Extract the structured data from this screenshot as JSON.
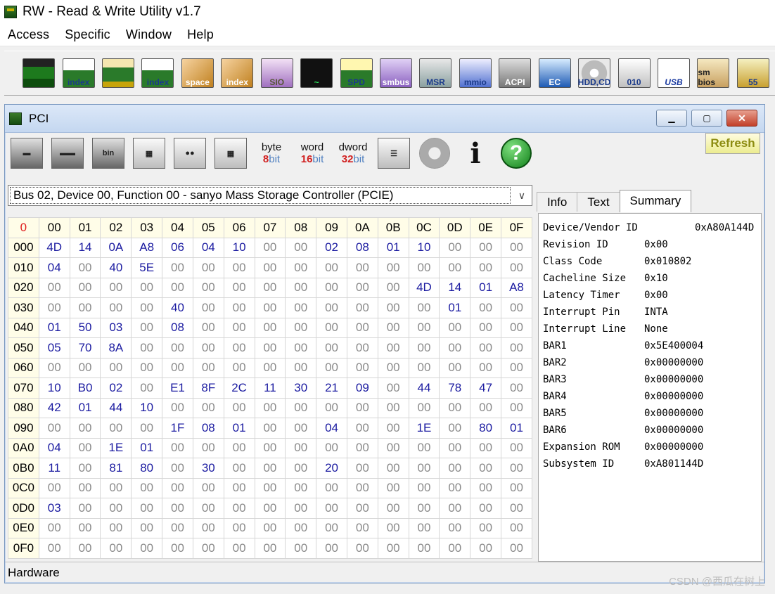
{
  "app": {
    "title": "RW - Read & Write Utility v1.7"
  },
  "menu": [
    {
      "label": "Access"
    },
    {
      "label": "Specific"
    },
    {
      "label": "Window"
    },
    {
      "label": "Help"
    }
  ],
  "toolbar": [
    {
      "name": "pci",
      "text": "",
      "cls": "ico-green"
    },
    {
      "name": "pci-index",
      "text": "index",
      "cls": "ico-idx"
    },
    {
      "name": "memory",
      "text": "",
      "cls": "ico-ram"
    },
    {
      "name": "memory-index",
      "text": "index",
      "cls": "ico-idx"
    },
    {
      "name": "io-space",
      "text": "space",
      "cls": "ico-io"
    },
    {
      "name": "io-index",
      "text": "index",
      "cls": "ico-io"
    },
    {
      "name": "sio",
      "text": "SIO",
      "cls": "ico-sio"
    },
    {
      "name": "oscilloscope",
      "text": "~",
      "cls": "ico-osc"
    },
    {
      "name": "spd",
      "text": "SPD",
      "cls": "ico-spd"
    },
    {
      "name": "smbus",
      "text": "smbus",
      "cls": "ico-smb"
    },
    {
      "name": "msr",
      "text": "MSR",
      "cls": "ico-msr"
    },
    {
      "name": "mmio",
      "text": "mmio",
      "cls": "ico-mmio"
    },
    {
      "name": "acpi",
      "text": "ACPI",
      "cls": "ico-acpi"
    },
    {
      "name": "ec",
      "text": "EC",
      "cls": "ico-ec"
    },
    {
      "name": "hdd-cd",
      "text": "HDD,CD",
      "cls": "ico-hdd"
    },
    {
      "name": "file-010",
      "text": "010",
      "cls": "ico-010"
    },
    {
      "name": "usb",
      "text": "USB",
      "cls": "ico-usb"
    },
    {
      "name": "smbios",
      "text": "sm bios",
      "cls": "ico-sm"
    },
    {
      "name": "more",
      "text": "55",
      "cls": "ico-55"
    }
  ],
  "pci_window": {
    "title": "PCI",
    "refresh": "Refresh",
    "bit_buttons": [
      {
        "top": "byte",
        "n": "8",
        "b": "bit"
      },
      {
        "top": "word",
        "n": "16",
        "b": "bit"
      },
      {
        "top": "dword",
        "n": "32",
        "b": "bit"
      }
    ],
    "device": "Bus 02, Device 00, Function 00 - sanyo Mass Storage Controller (PCIE)",
    "tabs": [
      {
        "label": "Info"
      },
      {
        "label": "Text"
      },
      {
        "label": "Summary"
      }
    ],
    "status": "Hardware"
  },
  "grid": {
    "corner": "0",
    "cols": [
      "00",
      "01",
      "02",
      "03",
      "04",
      "05",
      "06",
      "07",
      "08",
      "09",
      "0A",
      "0B",
      "0C",
      "0D",
      "0E",
      "0F"
    ],
    "rows": [
      {
        "h": "000",
        "v": [
          "4D",
          "14",
          "0A",
          "A8",
          "06",
          "04",
          "10",
          "00",
          "00",
          "02",
          "08",
          "01",
          "10",
          "00",
          "00",
          "00"
        ]
      },
      {
        "h": "010",
        "v": [
          "04",
          "00",
          "40",
          "5E",
          "00",
          "00",
          "00",
          "00",
          "00",
          "00",
          "00",
          "00",
          "00",
          "00",
          "00",
          "00"
        ]
      },
      {
        "h": "020",
        "v": [
          "00",
          "00",
          "00",
          "00",
          "00",
          "00",
          "00",
          "00",
          "00",
          "00",
          "00",
          "00",
          "4D",
          "14",
          "01",
          "A8"
        ]
      },
      {
        "h": "030",
        "v": [
          "00",
          "00",
          "00",
          "00",
          "40",
          "00",
          "00",
          "00",
          "00",
          "00",
          "00",
          "00",
          "00",
          "01",
          "00",
          "00"
        ]
      },
      {
        "h": "040",
        "v": [
          "01",
          "50",
          "03",
          "00",
          "08",
          "00",
          "00",
          "00",
          "00",
          "00",
          "00",
          "00",
          "00",
          "00",
          "00",
          "00"
        ]
      },
      {
        "h": "050",
        "v": [
          "05",
          "70",
          "8A",
          "00",
          "00",
          "00",
          "00",
          "00",
          "00",
          "00",
          "00",
          "00",
          "00",
          "00",
          "00",
          "00"
        ]
      },
      {
        "h": "060",
        "v": [
          "00",
          "00",
          "00",
          "00",
          "00",
          "00",
          "00",
          "00",
          "00",
          "00",
          "00",
          "00",
          "00",
          "00",
          "00",
          "00"
        ]
      },
      {
        "h": "070",
        "v": [
          "10",
          "B0",
          "02",
          "00",
          "E1",
          "8F",
          "2C",
          "11",
          "30",
          "21",
          "09",
          "00",
          "44",
          "78",
          "47",
          "00"
        ]
      },
      {
        "h": "080",
        "v": [
          "42",
          "01",
          "44",
          "10",
          "00",
          "00",
          "00",
          "00",
          "00",
          "00",
          "00",
          "00",
          "00",
          "00",
          "00",
          "00"
        ]
      },
      {
        "h": "090",
        "v": [
          "00",
          "00",
          "00",
          "00",
          "1F",
          "08",
          "01",
          "00",
          "00",
          "04",
          "00",
          "00",
          "1E",
          "00",
          "80",
          "01"
        ]
      },
      {
        "h": "0A0",
        "v": [
          "04",
          "00",
          "1E",
          "01",
          "00",
          "00",
          "00",
          "00",
          "00",
          "00",
          "00",
          "00",
          "00",
          "00",
          "00",
          "00"
        ]
      },
      {
        "h": "0B0",
        "v": [
          "11",
          "00",
          "81",
          "80",
          "00",
          "30",
          "00",
          "00",
          "00",
          "20",
          "00",
          "00",
          "00",
          "00",
          "00",
          "00"
        ]
      },
      {
        "h": "0C0",
        "v": [
          "00",
          "00",
          "00",
          "00",
          "00",
          "00",
          "00",
          "00",
          "00",
          "00",
          "00",
          "00",
          "00",
          "00",
          "00",
          "00"
        ]
      },
      {
        "h": "0D0",
        "v": [
          "03",
          "00",
          "00",
          "00",
          "00",
          "00",
          "00",
          "00",
          "00",
          "00",
          "00",
          "00",
          "00",
          "00",
          "00",
          "00"
        ]
      },
      {
        "h": "0E0",
        "v": [
          "00",
          "00",
          "00",
          "00",
          "00",
          "00",
          "00",
          "00",
          "00",
          "00",
          "00",
          "00",
          "00",
          "00",
          "00",
          "00"
        ]
      },
      {
        "h": "0F0",
        "v": [
          "00",
          "00",
          "00",
          "00",
          "00",
          "00",
          "00",
          "00",
          "00",
          "00",
          "00",
          "00",
          "00",
          "00",
          "00",
          "00"
        ]
      }
    ]
  },
  "summary": [
    {
      "k": "Device/Vendor ID",
      "v": "0xA80A144D",
      "wide": true
    },
    {
      "k": "Revision ID",
      "v": "0x00"
    },
    {
      "k": "Class Code",
      "v": "0x010802"
    },
    {
      "k": "Cacheline Size",
      "v": "0x10"
    },
    {
      "k": "Latency Timer",
      "v": "0x00"
    },
    {
      "k": "Interrupt Pin",
      "v": "INTA"
    },
    {
      "k": "Interrupt Line",
      "v": "None"
    },
    {
      "k": "BAR1",
      "v": "0x5E400004"
    },
    {
      "k": "BAR2",
      "v": "0x00000000"
    },
    {
      "k": "BAR3",
      "v": "0x00000000"
    },
    {
      "k": "BAR4",
      "v": "0x00000000"
    },
    {
      "k": "BAR5",
      "v": "0x00000000"
    },
    {
      "k": "BAR6",
      "v": "0x00000000"
    },
    {
      "k": "Expansion ROM",
      "v": "0x00000000"
    },
    {
      "k": "Subsystem ID",
      "v": "0xA801144D"
    }
  ],
  "watermark": "CSDN @西瓜在树上"
}
